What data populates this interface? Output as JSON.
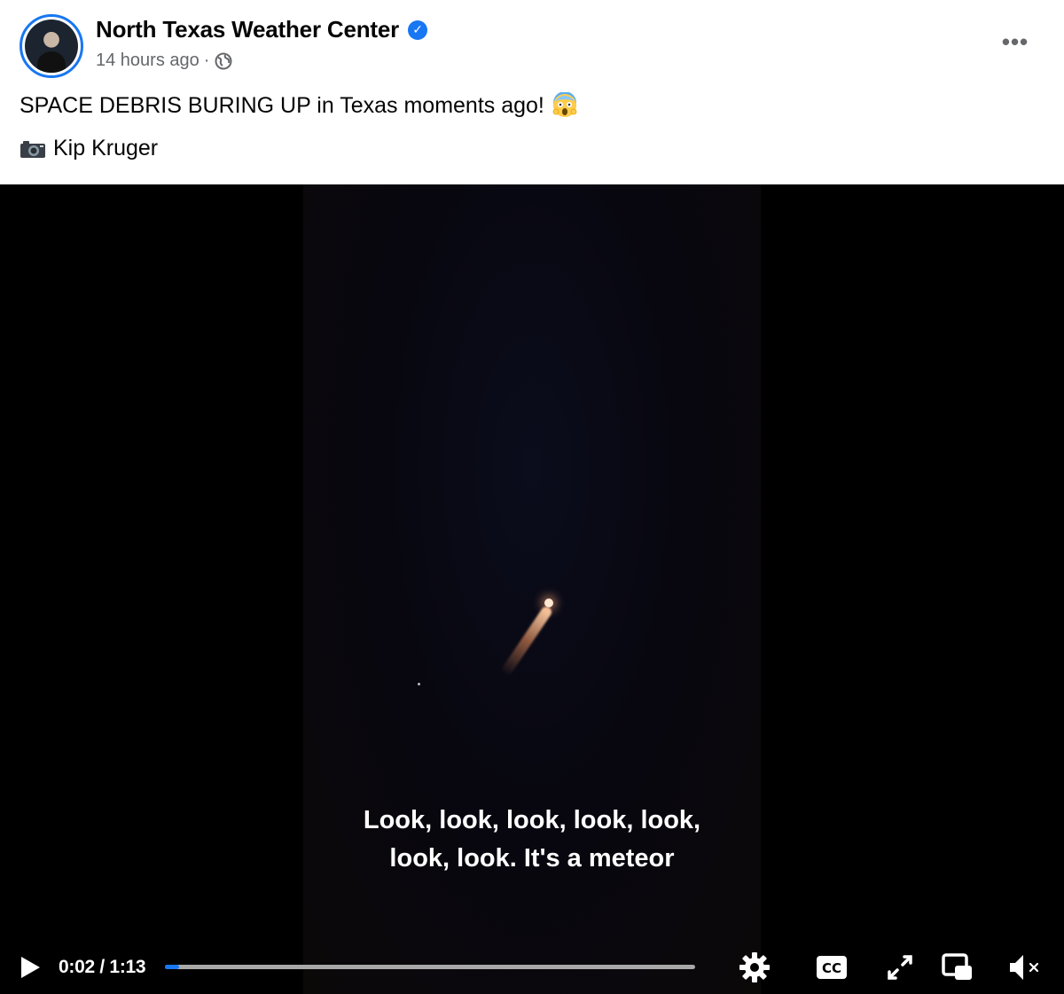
{
  "post": {
    "page_name": "North Texas Weather Center",
    "verified_icon": "verified-badge-icon",
    "timestamp": "14 hours ago",
    "separator": "·",
    "audience_icon": "globe-icon",
    "text": "SPACE DEBRIS BURING UP in Texas moments ago!",
    "text_emoji": "screaming-face-emoji",
    "credit_icon": "camera-emoji",
    "credit": "Kip Kruger",
    "more_label": "•••"
  },
  "video": {
    "caption_line1": "Look, look, look, look, look,",
    "caption_line2": "look, look. It's a meteor",
    "current_time": "0:02",
    "duration": "1:13",
    "time_display": "0:02 / 1:13",
    "progress_fraction": 0.027,
    "icons": [
      "play-icon",
      "settings-gear-icon",
      "closed-captions-icon",
      "fullscreen-icon",
      "picture-in-picture-icon",
      "muted-volume-icon"
    ]
  },
  "colors": {
    "accent": "#1877f2",
    "secondary_text": "#65676b",
    "video_background": "#000000"
  }
}
